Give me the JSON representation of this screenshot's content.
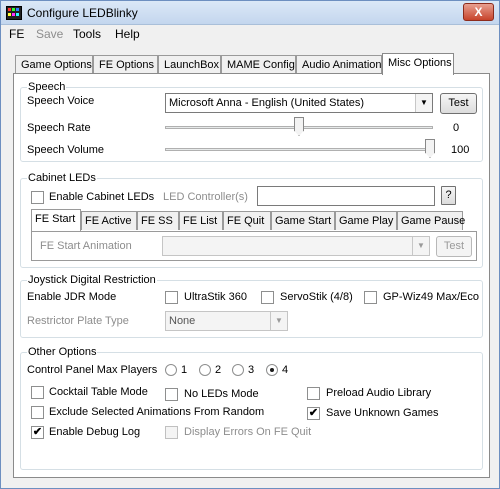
{
  "window": {
    "title": "Configure LEDBlinky",
    "close_glyph": "X",
    "icon": "ledblinky-app-icon"
  },
  "menu": [
    "FE",
    "Save",
    "Tools",
    "Help"
  ],
  "tabs": [
    "Game Options",
    "FE Options",
    "LaunchBox",
    "MAME Config",
    "Audio Animation",
    "Misc Options"
  ],
  "active_tab": "Misc Options",
  "speech": {
    "group_label": "Speech",
    "voice_label": "Speech Voice",
    "voice_value": "Microsoft Anna - English (United States)",
    "test_label": "Test",
    "rate_label": "Speech Rate",
    "rate_value": "0",
    "rate_level": 0.5,
    "volume_label": "Speech Volume",
    "volume_value": "100",
    "volume_level": 1.0
  },
  "cabinet": {
    "group_label": "Cabinet LEDs",
    "enable_label": "Enable Cabinet LEDs",
    "enable_checked": false,
    "controllers_label": "LED Controller(s)",
    "controllers_value": "",
    "help_label": "?",
    "subtabs": [
      "FE Start",
      "FE Active",
      "FE SS",
      "FE List",
      "FE Quit",
      "Game Start",
      "Game Play",
      "Game Pause"
    ],
    "active_subtab": "FE Start",
    "animation_label": "FE Start Animation",
    "animation_value": "",
    "test_label": "Test"
  },
  "joystick": {
    "group_label": "Joystick Digital Restriction",
    "enable_label": "Enable JDR Mode",
    "options": [
      {
        "label": "UltraStik 360",
        "checked": false
      },
      {
        "label": "ServoStik (4/8)",
        "checked": false
      },
      {
        "label": "GP-Wiz49 Max/Eco",
        "checked": false
      }
    ],
    "plate_label": "Restrictor Plate Type",
    "plate_value": "None"
  },
  "other": {
    "group_label": "Other Options",
    "max_players_label": "Control Panel Max Players",
    "players": [
      "1",
      "2",
      "3",
      "4"
    ],
    "selected_players": "4",
    "checks": [
      {
        "label": "Cocktail Table Mode",
        "checked": false,
        "enabled": true
      },
      {
        "label": "No LEDs Mode",
        "checked": false,
        "enabled": true
      },
      {
        "label": "Preload Audio Library",
        "checked": false,
        "enabled": true
      },
      {
        "label": "Exclude Selected Animations From Random",
        "checked": false,
        "enabled": true
      },
      {
        "label": "Save Unknown Games",
        "checked": true,
        "enabled": true
      },
      {
        "label": "Enable Debug Log",
        "checked": true,
        "enabled": true
      },
      {
        "label": "Display Errors On FE Quit",
        "checked": false,
        "enabled": false
      }
    ]
  },
  "glyphs": {
    "check": "✔",
    "dropdown": "▼"
  }
}
